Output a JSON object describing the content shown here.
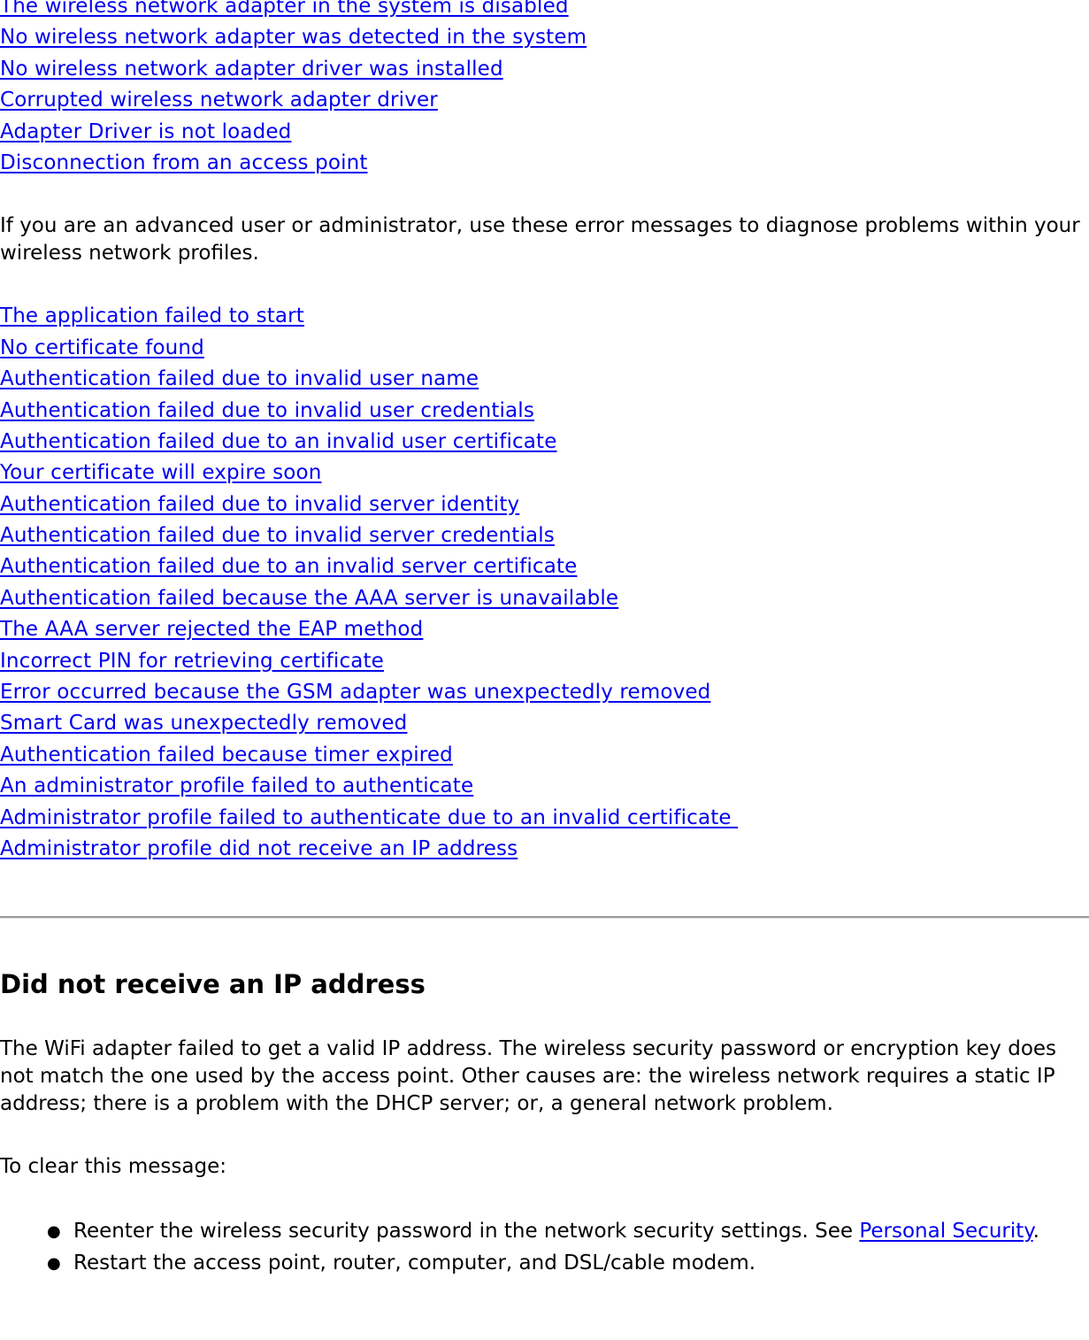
{
  "adapter_issues": [
    "The wireless network adapter in the system is disabled",
    "No wireless network adapter was detected in the system",
    "No wireless network adapter driver was installed",
    "Corrupted wireless network adapter driver",
    "Adapter Driver is not loaded",
    "Disconnection from an access point"
  ],
  "intro_text": "If you are an advanced user or administrator, use these error messages to diagnose problems within your wireless network profiles.",
  "profile_errors": [
    "The application failed to start",
    "No certificate found",
    "Authentication failed due to invalid user name",
    "Authentication failed due to invalid user credentials",
    "Authentication failed due to an invalid user certificate",
    "Your certificate will expire soon",
    "Authentication failed due to invalid server identity",
    "Authentication failed due to invalid server credentials",
    "Authentication failed due to an invalid server certificate",
    "Authentication failed because the AAA server is unavailable",
    "The AAA server rejected the EAP method",
    "Incorrect PIN for retrieving certificate",
    "Error occurred because the GSM adapter was unexpectedly removed",
    "Smart Card was unexpectedly removed",
    "Authentication failed because timer expired",
    "An administrator profile failed to authenticate",
    "Administrator profile failed to authenticate due to an invalid certificate ",
    "Administrator profile did not receive an IP address"
  ],
  "section": {
    "heading": "Did not receive an IP address",
    "description": "The WiFi adapter failed to get a valid IP address. The wireless security password or encryption key does not match the one used by the access point. Other causes are: the wireless network requires a static IP address; there is a problem with the DHCP server; or, a general network problem.",
    "clear_label": "To clear this message:",
    "steps": {
      "step1_text": "Reenter the wireless security password in the network security settings. See ",
      "step1_link": "Personal Security",
      "step1_suffix": ".",
      "step2_text": "Restart the access point, router, computer, and DSL/cable modem."
    },
    "bullet": "●"
  }
}
